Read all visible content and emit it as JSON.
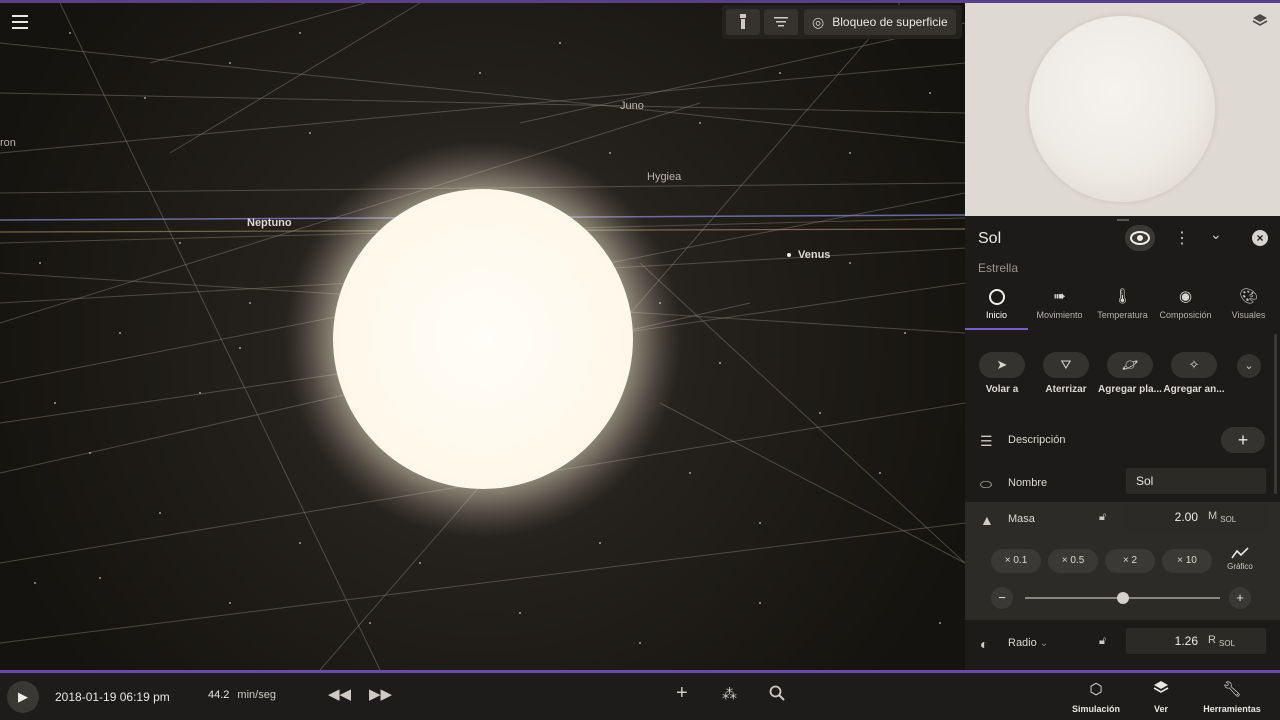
{
  "colors": {
    "accent": "#7a5cc9",
    "panel_bg": "#1c1b19",
    "sun": "#fffaf0"
  },
  "viewport": {
    "labels": {
      "juno": "Juno",
      "hygiea": "Hygiea",
      "neptuno": "Neptuno",
      "venus": "Venus",
      "partial_left": "ron"
    }
  },
  "top_toolbar": {
    "flashlight_icon": "flashlight-icon",
    "filter_icon": "filter-icon",
    "surface_lock_label": "Bloqueo de superficie"
  },
  "panel": {
    "title": "Sol",
    "subtitle": "Estrella",
    "tabs": [
      {
        "label": "Inicio",
        "icon": "circle-icon"
      },
      {
        "label": "Movimiento",
        "icon": "motion-icon"
      },
      {
        "label": "Temperatura",
        "icon": "thermometer-icon"
      },
      {
        "label": "Composición",
        "icon": "composition-icon"
      },
      {
        "label": "Visuales",
        "icon": "palette-icon"
      }
    ],
    "actions": [
      {
        "label": "Volar a"
      },
      {
        "label": "Aterrizar"
      },
      {
        "label": "Agregar pla..."
      },
      {
        "label": "Agregar an..."
      }
    ],
    "description_label": "Descripción",
    "name_label": "Nombre",
    "name_value": "Sol",
    "mass": {
      "label": "Masa",
      "value": "2.00",
      "unit": "M",
      "unit_sub": "SOL",
      "multipliers": [
        "× 0.1",
        "× 0.5",
        "× 2",
        "× 10"
      ],
      "graph_label": "Gráfico",
      "slider_fraction": 0.5
    },
    "radius": {
      "label": "Radio",
      "value": "1.26",
      "unit": "R",
      "unit_sub": "SOL"
    }
  },
  "bottom_bar": {
    "date": "2018-01-19 06:19 pm",
    "speed_value": "44.2",
    "speed_unit": "min/seg",
    "tools": [
      {
        "label": "Simulación"
      },
      {
        "label": "Ver"
      },
      {
        "label": "Herramientas"
      }
    ]
  }
}
